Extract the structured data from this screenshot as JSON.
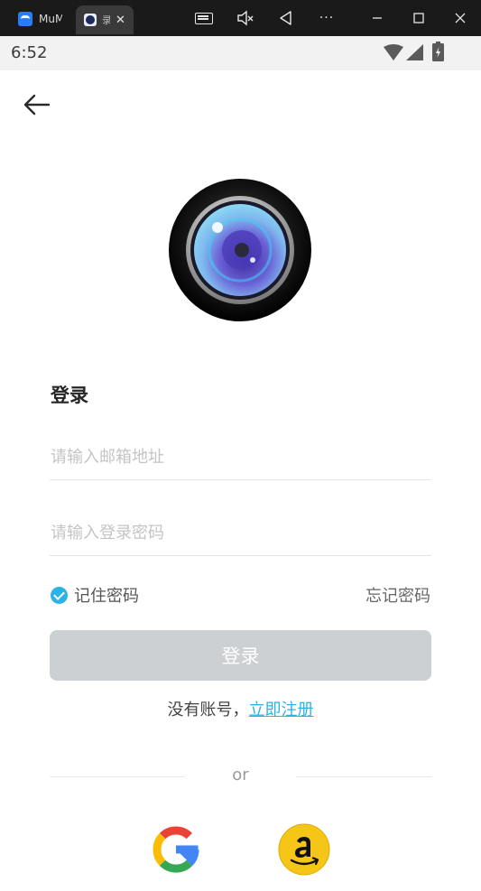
{
  "window": {
    "tab1_label": "MuMu",
    "tab2_label": "录",
    "tab2_close": "✕",
    "icons": [
      "keyboard-icon",
      "mute-icon",
      "back-nav-icon",
      "more-icon",
      "minimize-icon",
      "maximize-icon",
      "close-icon"
    ],
    "more": "···"
  },
  "status_bar": {
    "time": "6:52"
  },
  "login": {
    "title": "登录",
    "email_placeholder": "请输入邮箱地址",
    "password_placeholder": "请输入登录密码",
    "remember_label": "记住密码",
    "remember_checked": true,
    "forgot_label": "忘记密码",
    "login_button": "登录",
    "no_account": "没有账号，",
    "register_link": "立即注册",
    "or": "or"
  },
  "colors": {
    "accent": "#2bb3e6",
    "button_disabled": "#ccd0d3"
  }
}
